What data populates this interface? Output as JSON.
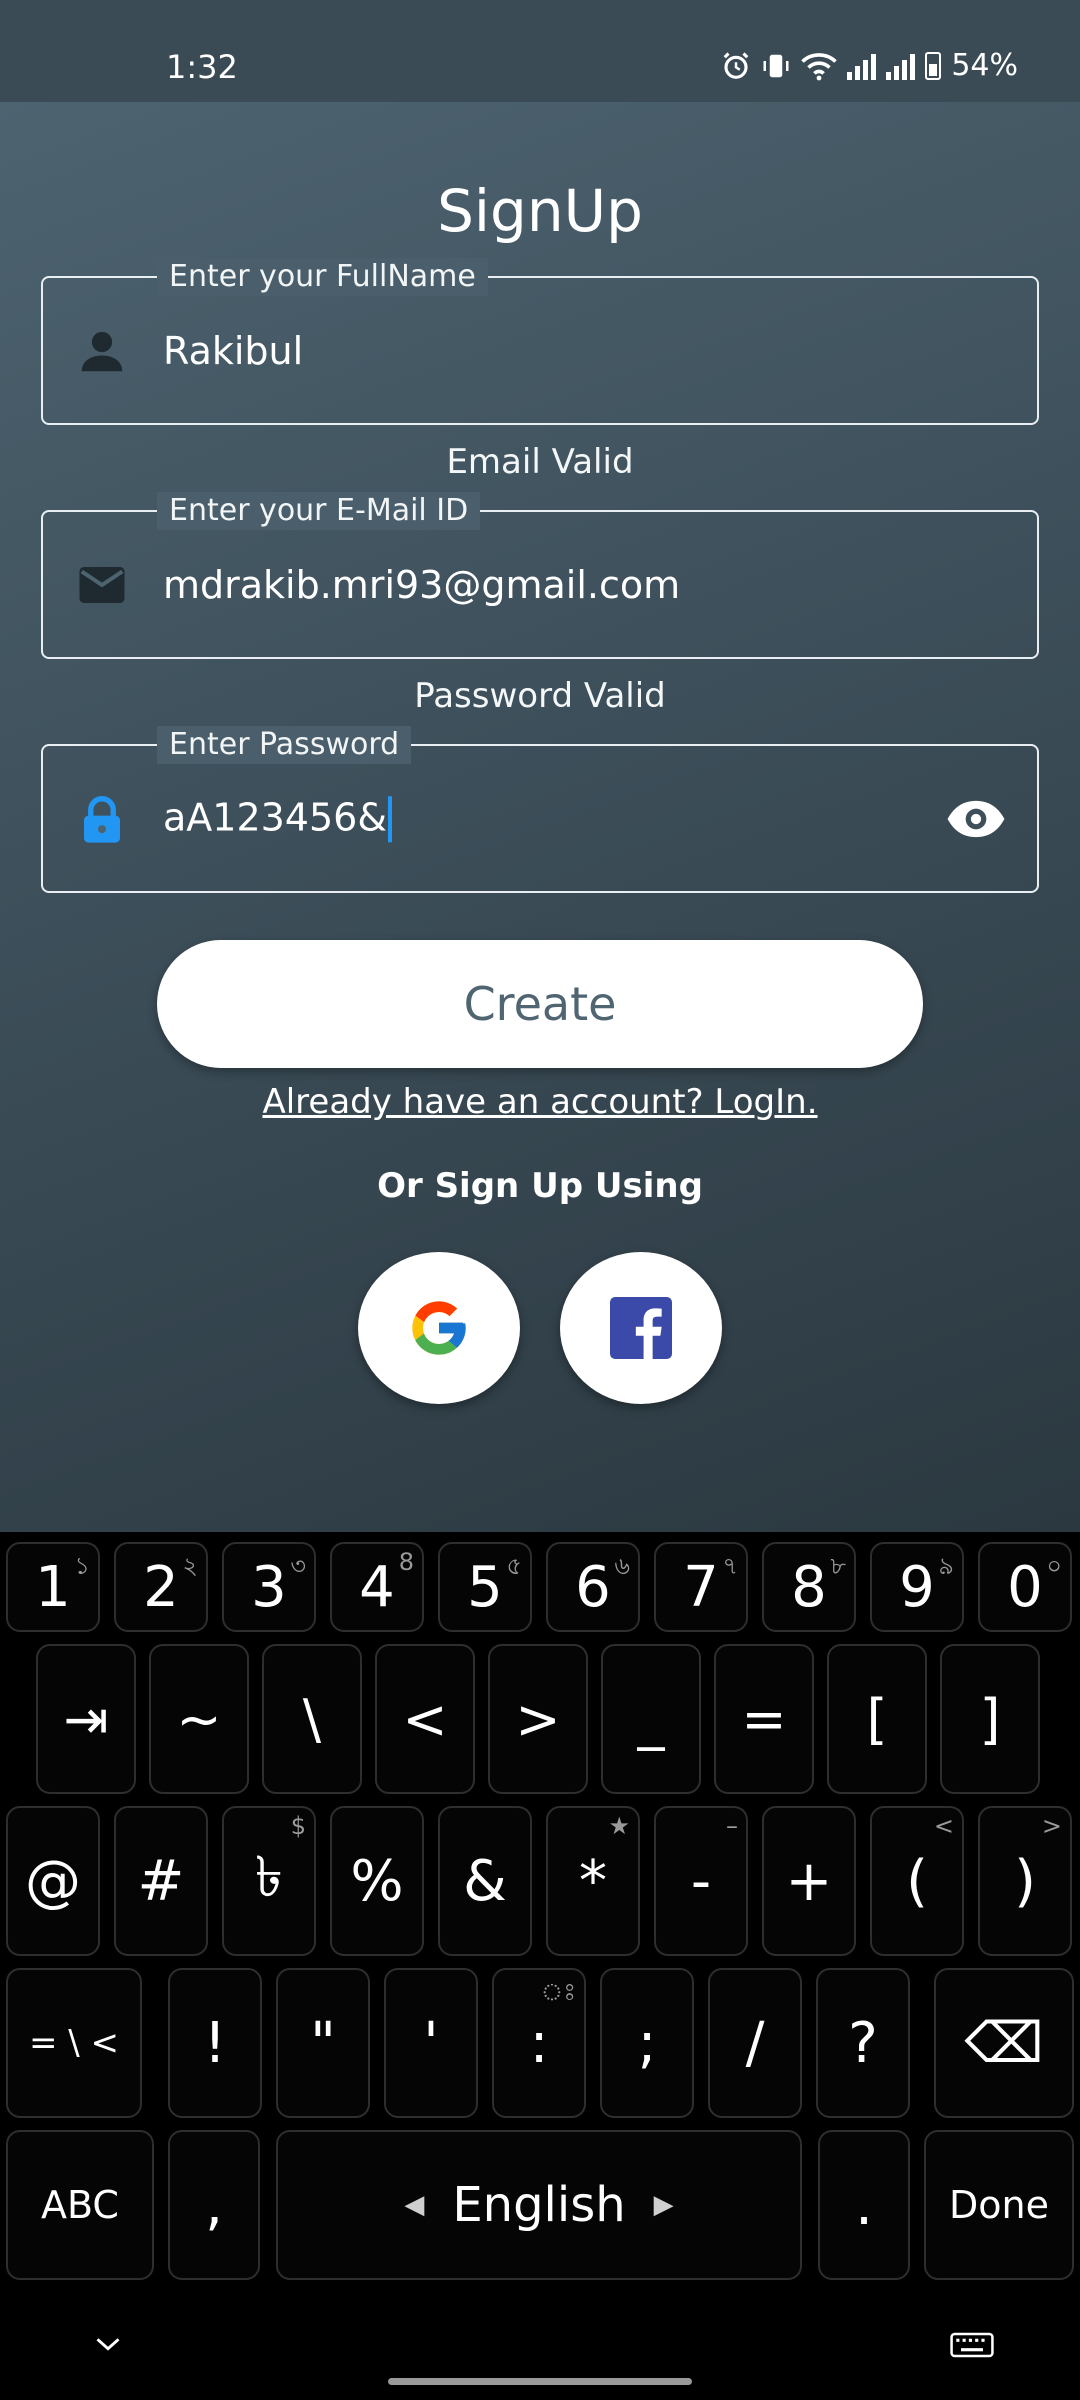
{
  "status": {
    "time": "1:32",
    "battery": "54%"
  },
  "title": "SignUp",
  "fields": {
    "fullname": {
      "label": "Enter your FullName",
      "value": "Rakibul"
    },
    "email": {
      "label": "Enter your E-Mail ID",
      "value": "mdrakib.mri93@gmail.com",
      "status": "Email Valid"
    },
    "password": {
      "label": "Enter Password",
      "value": "aA123456&",
      "status": "Password Valid"
    }
  },
  "create_label": "Create",
  "login_link": "Already have an account? LogIn.",
  "or_text": "Or Sign Up Using",
  "colors": {
    "accent": "#2196f3",
    "app_bg": "#3d4f5a",
    "button_text": "#4f6571"
  },
  "keyboard": {
    "row1": [
      {
        "k": "1",
        "h": "১"
      },
      {
        "k": "2",
        "h": "২"
      },
      {
        "k": "3",
        "h": "৩"
      },
      {
        "k": "4",
        "h": "8"
      },
      {
        "k": "5",
        "h": "৫"
      },
      {
        "k": "6",
        "h": "৬"
      },
      {
        "k": "7",
        "h": "৭"
      },
      {
        "k": "8",
        "h": "৮"
      },
      {
        "k": "9",
        "h": "৯"
      },
      {
        "k": "0",
        "h": "০"
      }
    ],
    "row2": [
      {
        "k": "⇥"
      },
      {
        "k": "~"
      },
      {
        "k": "\\"
      },
      {
        "k": "<"
      },
      {
        "k": ">"
      },
      {
        "k": "_"
      },
      {
        "k": "="
      },
      {
        "k": "["
      },
      {
        "k": "]"
      }
    ],
    "row3": [
      {
        "k": "@"
      },
      {
        "k": "#"
      },
      {
        "k": "৳",
        "h": "$"
      },
      {
        "k": "%"
      },
      {
        "k": "&"
      },
      {
        "k": "*",
        "h": "★"
      },
      {
        "k": "-",
        "h": "–"
      },
      {
        "k": "+"
      },
      {
        "k": "(",
        "h": "<"
      },
      {
        "k": ")",
        "h": ">"
      }
    ],
    "row4": [
      {
        "k": "= \\ <"
      },
      {
        "k": "!"
      },
      {
        "k": "\""
      },
      {
        "k": "'"
      },
      {
        "k": ":",
        "h": "ঃ"
      },
      {
        "k": ";"
      },
      {
        "k": "/"
      },
      {
        "k": "?"
      },
      {
        "k": "⌫"
      }
    ],
    "row5": {
      "abc": "ABC",
      "comma": ",",
      "space": "English",
      "period": ".",
      "done": "Done"
    }
  }
}
